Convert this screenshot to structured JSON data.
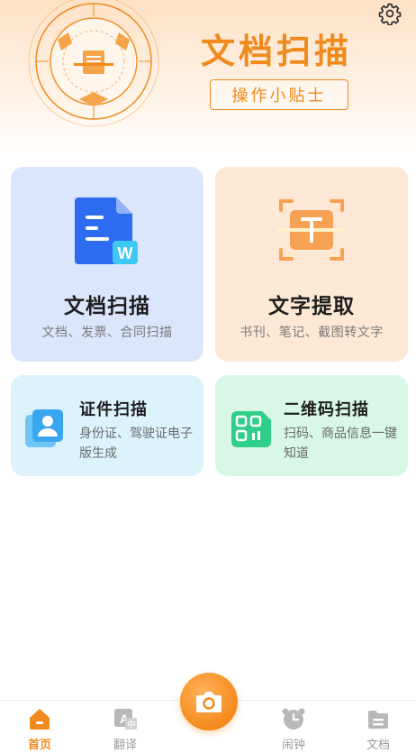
{
  "hero": {
    "title": "文档扫描",
    "tips_label": "操作小贴士"
  },
  "cards": {
    "doc_scan": {
      "title": "文档扫描",
      "subtitle": "文档、发票、合同扫描"
    },
    "text_extract": {
      "title": "文字提取",
      "subtitle": "书刊、笔记、截图转文字"
    },
    "id_scan": {
      "title": "证件扫描",
      "subtitle": "身份证、驾驶证电子版生成"
    },
    "qr_scan": {
      "title": "二维码扫描",
      "subtitle": "扫码、商品信息一键知道"
    }
  },
  "tabbar": {
    "home": "首页",
    "translate": "翻译",
    "clock": "闹钟",
    "docs": "文档",
    "active": "home"
  },
  "icons": {
    "settings": "gear-icon",
    "camera": "camera-icon",
    "home": "home-icon",
    "translate": "translate-icon",
    "clock": "alarm-clock-icon",
    "docs": "folder-icon"
  },
  "colors": {
    "accent": "#f08a1c",
    "card_doc_bg": "#dbe6fc",
    "card_text_bg": "#fde8d6",
    "card_id_bg": "#ddf3fb",
    "card_qr_bg": "#d8f7e6"
  }
}
